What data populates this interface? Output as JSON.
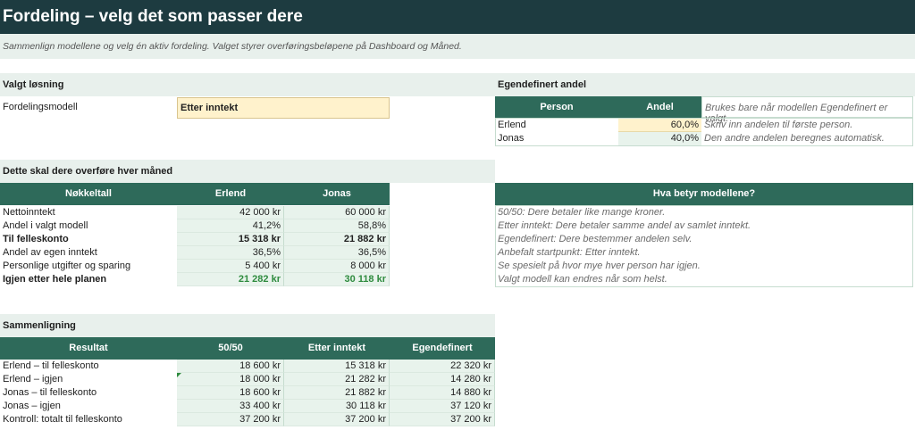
{
  "title": "Fordeling – velg det som passer dere",
  "subtitle": "Sammenlign modellene og velg én aktiv fordeling. Valget styrer overføringsbeløpene på Dashboard og Måned.",
  "selected": {
    "heading": "Valgt løsning",
    "label": "Fordelingsmodell",
    "value": "Etter inntekt"
  },
  "custom": {
    "heading": "Egendefinert andel",
    "col_person": "Person",
    "col_share": "Andel",
    "header_note": "Brukes bare når modellen Egendefinert er valgt.",
    "rows": [
      {
        "name": "Erlend",
        "share": "60,0%",
        "note": "Skriv inn andelen til første person."
      },
      {
        "name": "Jonas",
        "share": "40,0%",
        "note": "Den andre andelen beregnes automatisk."
      }
    ]
  },
  "monthly": {
    "heading": "Dette skal dere overføre hver måned",
    "col_key": "Nøkkeltall",
    "col_a": "Erlend",
    "col_b": "Jonas",
    "rows": [
      {
        "label": "Nettoinntekt",
        "a": "42 000 kr",
        "b": "60 000 kr"
      },
      {
        "label": "Andel i valgt modell",
        "a": "41,2%",
        "b": "58,8%"
      },
      {
        "label": "Til felleskonto",
        "a": "15 318 kr",
        "b": "21 882 kr"
      },
      {
        "label": "Andel av egen inntekt",
        "a": "36,5%",
        "b": "36,5%"
      },
      {
        "label": "Personlige utgifter og sparing",
        "a": "5 400 kr",
        "b": "8 000 kr"
      },
      {
        "label": "Igjen etter hele planen",
        "a": "21 282 kr",
        "b": "30 118 kr"
      }
    ]
  },
  "models": {
    "heading": "Hva betyr modellene?",
    "lines": [
      "50/50: Dere betaler like mange kroner.",
      "Etter inntekt: Dere betaler samme andel av samlet inntekt.",
      "Egendefinert: Dere bestemmer andelen selv.",
      "Anbefalt startpunkt: Etter inntekt.",
      "Se spesielt på hvor mye hver person har igjen.",
      "Valgt modell kan endres når som helst."
    ]
  },
  "comparison": {
    "heading": "Sammenligning",
    "col_result": "Resultat",
    "col_1": "50/50",
    "col_2": "Etter inntekt",
    "col_3": "Egendefinert",
    "rows": [
      {
        "label": "Erlend – til felleskonto",
        "v1": "18 600 kr",
        "v2": "15 318 kr",
        "v3": "22 320 kr"
      },
      {
        "label": "Erlend – igjen",
        "v1": "18 000 kr",
        "v2": "21 282 kr",
        "v3": "14 280 kr"
      },
      {
        "label": "Jonas – til felleskonto",
        "v1": "18 600 kr",
        "v2": "21 882 kr",
        "v3": "14 880 kr"
      },
      {
        "label": "Jonas – igjen",
        "v1": "33 400 kr",
        "v2": "30 118 kr",
        "v3": "37 120 kr"
      },
      {
        "label": "Kontroll: totalt til felleskonto",
        "v1": "37 200 kr",
        "v2": "37 200 kr",
        "v3": "37 200 kr"
      }
    ]
  }
}
